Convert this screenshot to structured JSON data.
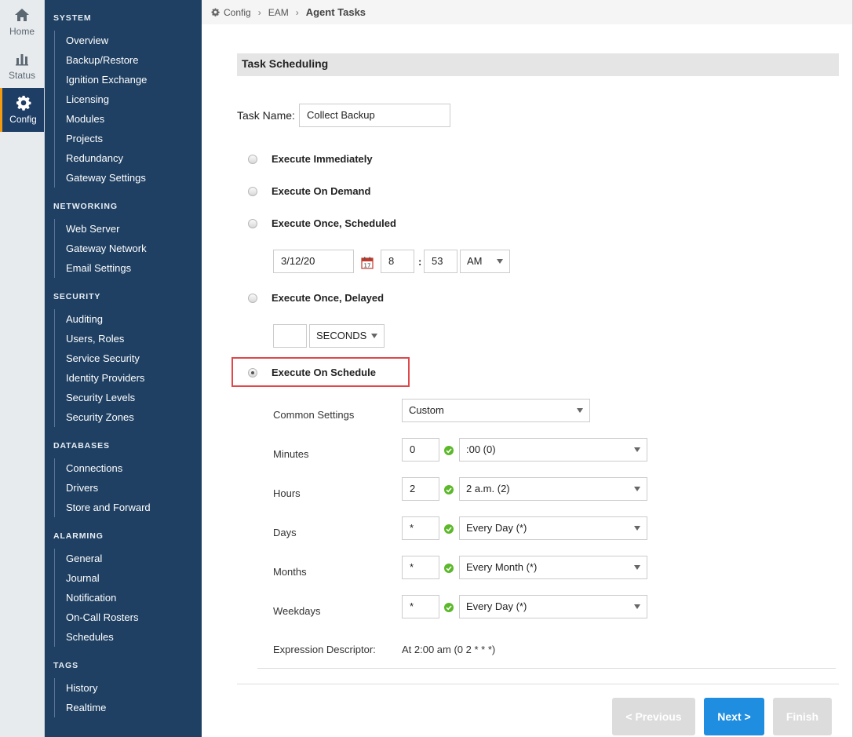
{
  "rail": [
    {
      "label": "Home",
      "icon": "home-icon"
    },
    {
      "label": "Status",
      "icon": "status-bars-icon"
    },
    {
      "label": "Config",
      "icon": "gear-icon",
      "active": true
    }
  ],
  "nav": {
    "sections": [
      {
        "heading": "SYSTEM",
        "items": [
          "Overview",
          "Backup/Restore",
          "Ignition Exchange",
          "Licensing",
          "Modules",
          "Projects",
          "Redundancy",
          "Gateway Settings"
        ]
      },
      {
        "heading": "NETWORKING",
        "items": [
          "Web Server",
          "Gateway Network",
          "Email Settings"
        ]
      },
      {
        "heading": "SECURITY",
        "items": [
          "Auditing",
          "Users, Roles",
          "Service Security",
          "Identity Providers",
          "Security Levels",
          "Security Zones"
        ]
      },
      {
        "heading": "DATABASES",
        "items": [
          "Connections",
          "Drivers",
          "Store and Forward"
        ]
      },
      {
        "heading": "ALARMING",
        "items": [
          "General",
          "Journal",
          "Notification",
          "On-Call Rosters",
          "Schedules"
        ]
      },
      {
        "heading": "TAGS",
        "items": [
          "History",
          "Realtime"
        ]
      }
    ]
  },
  "breadcrumb": {
    "config": "Config",
    "eam": "EAM",
    "current": "Agent Tasks"
  },
  "panel": {
    "title": "Task Scheduling"
  },
  "task": {
    "label": "Task Name:",
    "value": "Collect Backup"
  },
  "options": {
    "immediately": "Execute Immediately",
    "on_demand": "Execute On Demand",
    "once_scheduled": "Execute Once, Scheduled",
    "once_delayed": "Execute Once, Delayed",
    "on_schedule": "Execute On Schedule"
  },
  "scheduled": {
    "date": "3/12/20",
    "hour": "8",
    "minute": "53",
    "ampm": "AM"
  },
  "delayed": {
    "value": "",
    "unit": "SECONDS"
  },
  "schedule": {
    "common_label": "Common Settings",
    "common_value": "Custom",
    "rows": [
      {
        "label": "Minutes",
        "value": "0",
        "select": ":00 (0)"
      },
      {
        "label": "Hours",
        "value": "2",
        "select": "2 a.m. (2)"
      },
      {
        "label": "Days",
        "value": "*",
        "select": "Every Day (*)"
      },
      {
        "label": "Months",
        "value": "*",
        "select": "Every Month (*)"
      },
      {
        "label": "Weekdays",
        "value": "*",
        "select": "Every Day (*)"
      }
    ],
    "descriptor_label": "Expression Descriptor:",
    "descriptor_value": "At 2:00 am (0 2 * * *)"
  },
  "buttons": {
    "previous": "< Previous",
    "next": "Next >",
    "finish": "Finish"
  },
  "colors": {
    "nav_bg": "#1f4063",
    "accent": "#1f8ee0",
    "highlight": "#e0474c",
    "valid": "#5cb82a"
  }
}
